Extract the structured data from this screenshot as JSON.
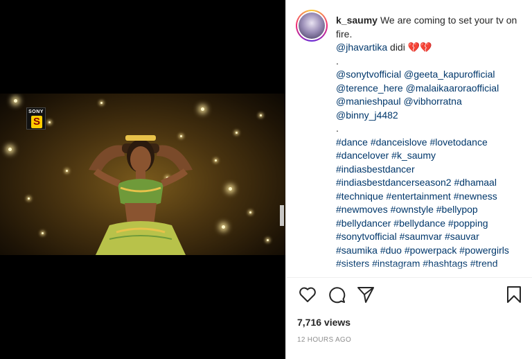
{
  "post": {
    "username": "k_saumy",
    "caption_first_line": "We are coming to set your tv on fire.",
    "mention_line": {
      "mention": "@jhavartika",
      "text": "didi",
      "emoji": "💔💔"
    },
    "separator": ".",
    "mentions": [
      "@sonytvofficial",
      "@geeta_kapurofficial",
      "@terence_here",
      "@malaikaaroraofficial",
      "@manieshpaul",
      "@vibhorratna",
      "@binny_j4482"
    ],
    "hashtags": [
      "#dance",
      "#danceislove",
      "#lovetodance",
      "#dancelover",
      "#k_saumy",
      "#indiasbestdancer",
      "#indiasbestdancerseason2",
      "#dhamaal",
      "#technique",
      "#entertainment",
      "#newness",
      "#newmoves",
      "#ownstyle",
      "#bellypop",
      "#bellydancer",
      "#bellydance",
      "#popping",
      "#sonytvofficial",
      "#saumvar",
      "#sauvar",
      "#saumika",
      "#duo",
      "#powerpack",
      "#powergirls",
      "#sisters",
      "#instagram",
      "#hashtags",
      "#trend"
    ],
    "views": "7,716 views",
    "time_ago": "12 HOURS AGO"
  },
  "video": {
    "channel_logo_text": "SONY",
    "channel_logo_mark": "S"
  },
  "actions": {
    "like_icon": "heart-outline-icon",
    "comment_icon": "comment-bubble-icon",
    "share_icon": "paper-plane-icon",
    "save_icon": "bookmark-icon"
  },
  "colors": {
    "text": "#262626",
    "link": "#00376b",
    "muted": "#8e8e8e",
    "heart": "#d0021b"
  }
}
